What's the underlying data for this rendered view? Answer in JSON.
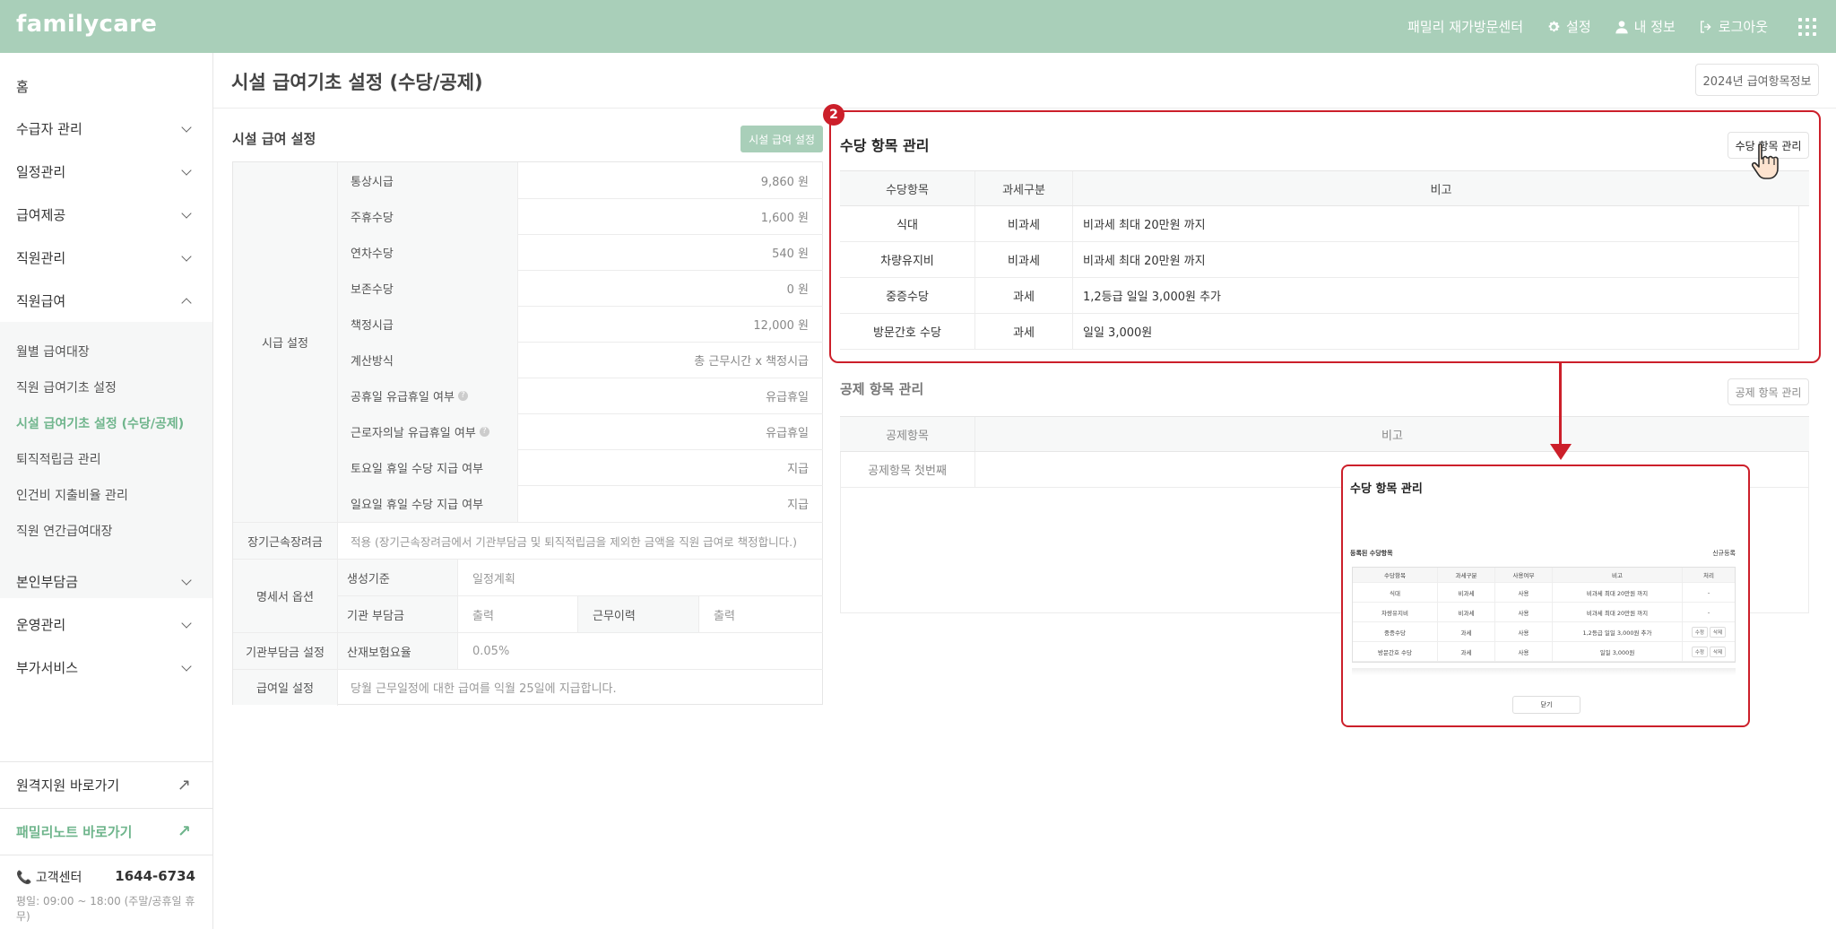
{
  "header": {
    "logo": "familycare",
    "center_name": "패밀리 재가방문센터",
    "settings": "설정",
    "my_info": "내 정보",
    "logout": "로그아웃",
    "icons": [
      "gear-icon",
      "user-icon",
      "logout-icon",
      "apps-grid-icon"
    ]
  },
  "sidebar": {
    "home": "홈",
    "items": [
      {
        "label": "수급자 관리"
      },
      {
        "label": "일정관리"
      },
      {
        "label": "급여제공"
      },
      {
        "label": "직원관리"
      },
      {
        "label": "직원급여"
      }
    ],
    "sub_items": [
      {
        "label": "월별 급여대장"
      },
      {
        "label": "직원 급여기초 설정"
      },
      {
        "label": "시설 급여기초 설정 (수당/공제)"
      },
      {
        "label": "퇴직적립금 관리"
      },
      {
        "label": "인건비 지출비율 관리"
      },
      {
        "label": "직원 연간급여대장"
      }
    ],
    "items2": [
      {
        "label": "본인부담금"
      },
      {
        "label": "운영관리"
      },
      {
        "label": "부가서비스"
      }
    ],
    "remote": "원격지원 바로가기",
    "familynote": "패밀리노트 바로가기",
    "cs_label": "고객센터",
    "cs_phone": "1644-6734",
    "cs_hours": "평일: 09:00 ~ 18:00 (주말/공휴일 휴무)"
  },
  "page": {
    "title": "시설 급여기초 설정 (수당/공제)",
    "year_button": "2024년 급여항목정보"
  },
  "facility": {
    "title": "시설 급여 설정",
    "button": "시설 급여 설정",
    "hourly_group": "시급 설정",
    "rows": [
      {
        "label": "통상시급",
        "value": "9,860 원"
      },
      {
        "label": "주휴수당",
        "value": "1,600 원"
      },
      {
        "label": "연차수당",
        "value": "540 원"
      },
      {
        "label": "보존수당",
        "value": "0 원"
      },
      {
        "label": "책정시급",
        "value": "12,000 원"
      },
      {
        "label": "계산방식",
        "value": "총 근무시간 x 책정시급"
      },
      {
        "label": "공휴일 유급휴일 여부",
        "value": "유급휴일"
      },
      {
        "label": "근로자의날 유급휴일 여부",
        "value": "유급휴일"
      },
      {
        "label": "토요일 휴일 수당 지급 여부",
        "value": "지급"
      },
      {
        "label": "일요일 휴일 수당 지급 여부",
        "value": "지급"
      }
    ],
    "long_term_label": "장기근속장려금",
    "long_term_value": "적용 (장기근속장려금에서 기관부담금 및 퇴직적립금을 제외한 금액을 직원 급여로 책정합니다.)",
    "statement_label": "명세서 옵션",
    "gen_basis_label": "생성기준",
    "gen_basis_value": "일정계획",
    "inst_burden_label": "기관 부담금",
    "inst_burden_value": "출력",
    "work_history_label": "근무이력",
    "work_history_value": "출력",
    "inst_setting_label": "기관부담금 설정",
    "industrial_label": "산재보험요율",
    "industrial_value": "0.05%",
    "payday_label": "급여일 설정",
    "payday_value": "당월 근무일정에 대한 급여를 익월 25일에 지급합니다."
  },
  "allowance": {
    "badge": "2",
    "title": "수당 항목 관리",
    "button": "수당 항목 관리",
    "columns": [
      "수당항목",
      "과세구분",
      "비고"
    ],
    "rows": [
      {
        "item": "식대",
        "tax": "비과세",
        "note": "비과세 최대 20만원 까지"
      },
      {
        "item": "차량유지비",
        "tax": "비과세",
        "note": "비과세 최대 20만원 까지"
      },
      {
        "item": "중증수당",
        "tax": "과세",
        "note": "1,2등급 일일 3,000원 추가"
      },
      {
        "item": "방문간호 수당",
        "tax": "과세",
        "note": "일일 3,000원"
      }
    ]
  },
  "deduction": {
    "title": "공제 항목 관리",
    "button": "공제 항목 관리",
    "columns": [
      "공제항목",
      "비고"
    ],
    "rows": [
      {
        "item": "공제항목 첫번째",
        "note": ""
      }
    ]
  },
  "popup": {
    "title": "수당 항목 관리",
    "subtitle": "등록된 수당항목",
    "new_button": "신규등록",
    "columns": [
      "수당항목",
      "과세구분",
      "사용여부",
      "비고",
      "처리"
    ],
    "rows": [
      {
        "item": "식대",
        "tax": "비과세",
        "use": "사용",
        "note": "비과세 최대 20만원 까지",
        "action": "-"
      },
      {
        "item": "차량유지비",
        "tax": "비과세",
        "use": "사용",
        "note": "비과세 최대 20만원 까지",
        "action": "-"
      },
      {
        "item": "중증수당",
        "tax": "과세",
        "use": "사용",
        "note": "1,2등급 일일 3,000원 추가",
        "edit": "수정",
        "delete": "삭제"
      },
      {
        "item": "방문간호 수당",
        "tax": "과세",
        "use": "사용",
        "note": "일일 3,000원",
        "edit": "수정",
        "delete": "삭제"
      }
    ],
    "close_button": "닫기"
  },
  "colors": {
    "brand": "#a9cfb9",
    "accent_text": "#6fb58c",
    "highlight": "#cc1f2a"
  }
}
